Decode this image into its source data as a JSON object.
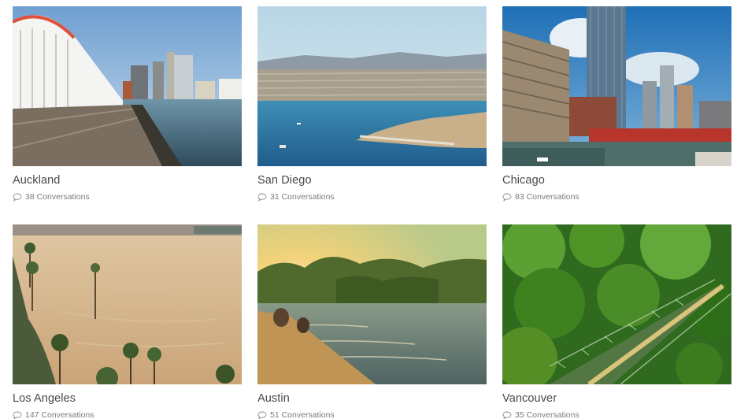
{
  "cities": [
    {
      "name": "Auckland",
      "conversations": "38 Conversations",
      "icon": "chat-bubble-icon"
    },
    {
      "name": "San Diego",
      "conversations": "31 Conversations",
      "icon": "chat-bubble-icon"
    },
    {
      "name": "Chicago",
      "conversations": "83 Conversations",
      "icon": "chat-bubble-icon"
    },
    {
      "name": "Los Angeles",
      "conversations": "147 Conversations",
      "icon": "chat-bubble-icon"
    },
    {
      "name": "Austin",
      "conversations": "51 Conversations",
      "icon": "chat-bubble-icon"
    },
    {
      "name": "Vancouver",
      "conversations": "35 Conversations",
      "icon": "chat-bubble-icon"
    }
  ],
  "colors": {
    "title_text": "#484848",
    "meta_text": "#7b7b7b",
    "background": "#ffffff"
  }
}
